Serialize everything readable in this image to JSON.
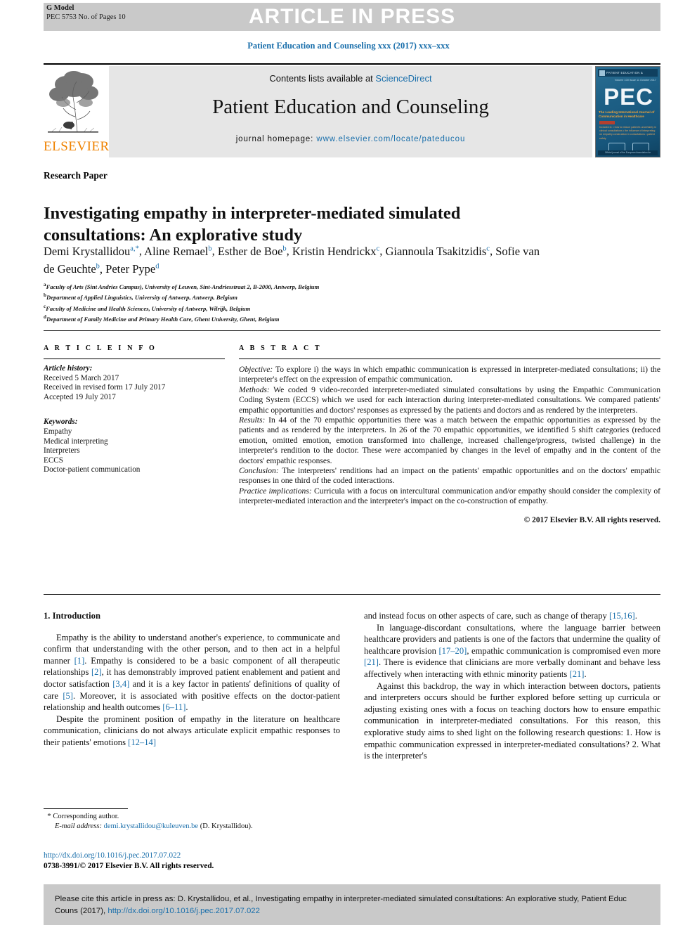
{
  "banner": {
    "article_in_press": "ARTICLE IN PRESS",
    "g_model": "G Model",
    "model_id": "PEC 5753 No. of Pages 10"
  },
  "running_head": "Patient Education and Counseling xxx (2017) xxx–xxx",
  "masthead": {
    "contents_prefix": "Contents lists available at ",
    "sciencedirect": "ScienceDirect",
    "journal_name": "Patient Education and Counseling",
    "homepage_label": "journal homepage: ",
    "homepage_url": "www.elsevier.com/locate/pateducou",
    "elsevier_wordmark": "ELSEVIER",
    "cover": {
      "top_bar": "PATIENT EDUCATION & COUNSELING",
      "issue": "Volume 100  Issue 11  October 2017",
      "title_abbrev": "PEC",
      "tagline": "The Leading International Journal of Communication in Healthcare",
      "list_items": "Included in: • how to reduce patient's uncertainty in clinical consultations • the influence of interpreting on empathy construction in consultations • patient safety",
      "footer": "Official journal of the European Association for Communication in Healthcare"
    }
  },
  "article": {
    "type_label": "Research Paper",
    "title": "Investigating empathy in interpreter-mediated simulated consultations: An explorative study",
    "authors": [
      {
        "name": "Demi Krystallidou",
        "marks": "a,*",
        "sep": ", "
      },
      {
        "name": "Aline Remael",
        "marks": "b",
        "sep": ", "
      },
      {
        "name": "Esther de Boe",
        "marks": "b",
        "sep": ", "
      },
      {
        "name": "Kristin Hendrickx",
        "marks": "c",
        "sep": ", "
      },
      {
        "name": "Giannoula Tsakitzidis",
        "marks": "c",
        "sep": ", "
      },
      {
        "name": "Sofie van de Geuchte",
        "marks": "b",
        "sep": ", "
      },
      {
        "name": "Peter Pype",
        "marks": "d",
        "sep": ""
      }
    ],
    "affiliations": [
      {
        "mark": "a",
        "text": "Faculty of Arts (Sint Andries Campus), University of Leuven, Sint-Andriesstraat 2, B-2000, Antwerp, Belgium"
      },
      {
        "mark": "b",
        "text": "Department of Applied Linguistics, University of Antwerp, Antwerp, Belgium"
      },
      {
        "mark": "c",
        "text": "Faculty of Medicine and Health Sciences, University of Antwerp, Wilrijk, Belgium"
      },
      {
        "mark": "d",
        "text": "Department of Family Medicine and Primary Health Care, Ghent University, Ghent, Belgium"
      }
    ]
  },
  "article_info": {
    "heading": "A R T I C L E   I N F O",
    "history_label": "Article history:",
    "history": [
      "Received 5 March 2017",
      "Received in revised form 17 July 2017",
      "Accepted 19 July 2017"
    ],
    "keywords_label": "Keywords:",
    "keywords": [
      "Empathy",
      "Medical interpreting",
      "Interpreters",
      "ECCS",
      "Doctor-patient communication"
    ]
  },
  "abstract": {
    "heading": "A B S T R A C T",
    "sections": [
      {
        "label": "Objective:",
        "text": " To explore i) the ways in which empathic communication is expressed in interpreter-mediated consultations; ii) the interpreter's effect on the expression of empathic communication."
      },
      {
        "label": "Methods:",
        "text": " We coded 9 video-recorded interpreter-mediated simulated consultations by using the Empathic Communication Coding System (ECCS) which we used for each interaction during interpreter-mediated consultations. We compared patients' empathic opportunities and doctors' responses as expressed by the patients and doctors and as rendered by the interpreters."
      },
      {
        "label": "Results:",
        "text": " In 44 of the 70 empathic opportunities there was a match between the empathic opportunities as expressed by the patients and as rendered by the interpreters. In 26 of the 70 empathic opportunities, we identified 5 shift categories (reduced emotion, omitted emotion, emotion transformed into challenge, increased challenge/progress, twisted challenge) in the interpreter's rendition to the doctor. These were accompanied by changes in the level of empathy and in the content of the doctors' empathic responses."
      },
      {
        "label": "Conclusion:",
        "text": " The interpreters' renditions had an impact on the patients' empathic opportunities and on the doctors' empathic responses in one third of the coded interactions."
      },
      {
        "label": "Practice implications:",
        "text": " Curricula with a focus on intercultural communication and/or empathy should consider the complexity of interpreter-mediated interaction and the interpreter's impact on the co-construction of empathy."
      }
    ],
    "copyright": "© 2017 Elsevier B.V. All rights reserved."
  },
  "body": {
    "section_title": "1. Introduction",
    "left_paragraphs": [
      "Empathy is the ability to understand another's experience, to communicate and confirm that understanding with the other person, and to then act in a helpful manner [1]. Empathy is considered to be a basic component of all therapeutic relationships [2], it has demonstrably improved patient enablement and patient and doctor satisfaction [3,4] and it is a key factor in patients' definitions of quality of care [5]. Moreover, it is associated with positive effects on the doctor-patient relationship and health outcomes [6–11].",
      "Despite the prominent position of empathy in the literature on healthcare communication, clinicians do not always articulate explicit empathic responses to their patients' emotions [12–14]"
    ],
    "right_paragraphs": [
      "and instead focus on other aspects of care, such as change of therapy [15,16].",
      "In language-discordant consultations, where the language barrier between healthcare providers and patients is one of the factors that undermine the quality of healthcare provision [17–20], empathic communication is compromised even more [21]. There is evidence that clinicians are more verbally dominant and behave less affectively when interacting with ethnic minority patients [21].",
      "Against this backdrop, the way in which interaction between doctors, patients and interpreters occurs should be further explored before setting up curricula or adjusting existing ones with a focus on teaching doctors how to ensure empathic communication in interpreter-mediated consultations. For this reason, this explorative study aims to shed light on the following research questions: 1. How is empathic communication expressed in interpreter-mediated consultations? 2. What is the interpreter's"
    ]
  },
  "footnotes": {
    "corresponding_marker": "*",
    "corresponding_text": "Corresponding author.",
    "email_label": "E-mail address:",
    "email": "demi.krystallidou@kuleuven.be",
    "email_suffix": " (D. Krystallidou)."
  },
  "footer": {
    "doi": "http://dx.doi.org/10.1016/j.pec.2017.07.022",
    "issn_line": "0738-3991/© 2017 Elsevier B.V. All rights reserved."
  },
  "citation_box": {
    "text_before": "Please cite this article in press as: D. Krystallidou, et al., Investigating empathy in interpreter-mediated simulated consultations: An explorative study, Patient Educ Couns (2017), ",
    "doi": "http://dx.doi.org/10.1016/j.pec.2017.07.022"
  },
  "colors": {
    "link_blue": "#1a6fab",
    "elsevier_orange": "#ef8200",
    "banner_gray": "#c9c9c9",
    "masthead_gray": "#e6e6e6"
  }
}
